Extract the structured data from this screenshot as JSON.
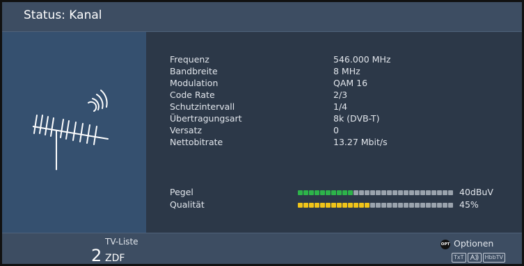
{
  "header": {
    "title": "Status: Kanal"
  },
  "icons": {
    "antenna": "antenna-signal-icon",
    "options_button": "opt-button-icon"
  },
  "info": [
    {
      "label": "Frequenz",
      "value": "546.000 MHz"
    },
    {
      "label": "Bandbreite",
      "value": "8 MHz"
    },
    {
      "label": "Modulation",
      "value": "QAM 16"
    },
    {
      "label": "Code Rate",
      "value": "2/3"
    },
    {
      "label": "Schutzintervall",
      "value": "1/4"
    },
    {
      "label": "Übertragungsart",
      "value": "8k (DVB-T)"
    },
    {
      "label": "Versatz",
      "value": "0"
    },
    {
      "label": "Nettobitrate",
      "value": "13.27 Mbit/s"
    }
  ],
  "meters": [
    {
      "label": "Pegel",
      "value_text": "40dBuV",
      "level": 0.36,
      "color": "#2db34a"
    },
    {
      "label": "Qualität",
      "value_text": "45%",
      "level": 0.45,
      "color": "#f0c419"
    }
  ],
  "footer": {
    "list_label": "TV-Liste",
    "channel_number": "2",
    "channel_name": "ZDF",
    "options_key": "OPT",
    "options_label": "Optionen",
    "badges": [
      "TxT",
      "HbbTV"
    ]
  }
}
